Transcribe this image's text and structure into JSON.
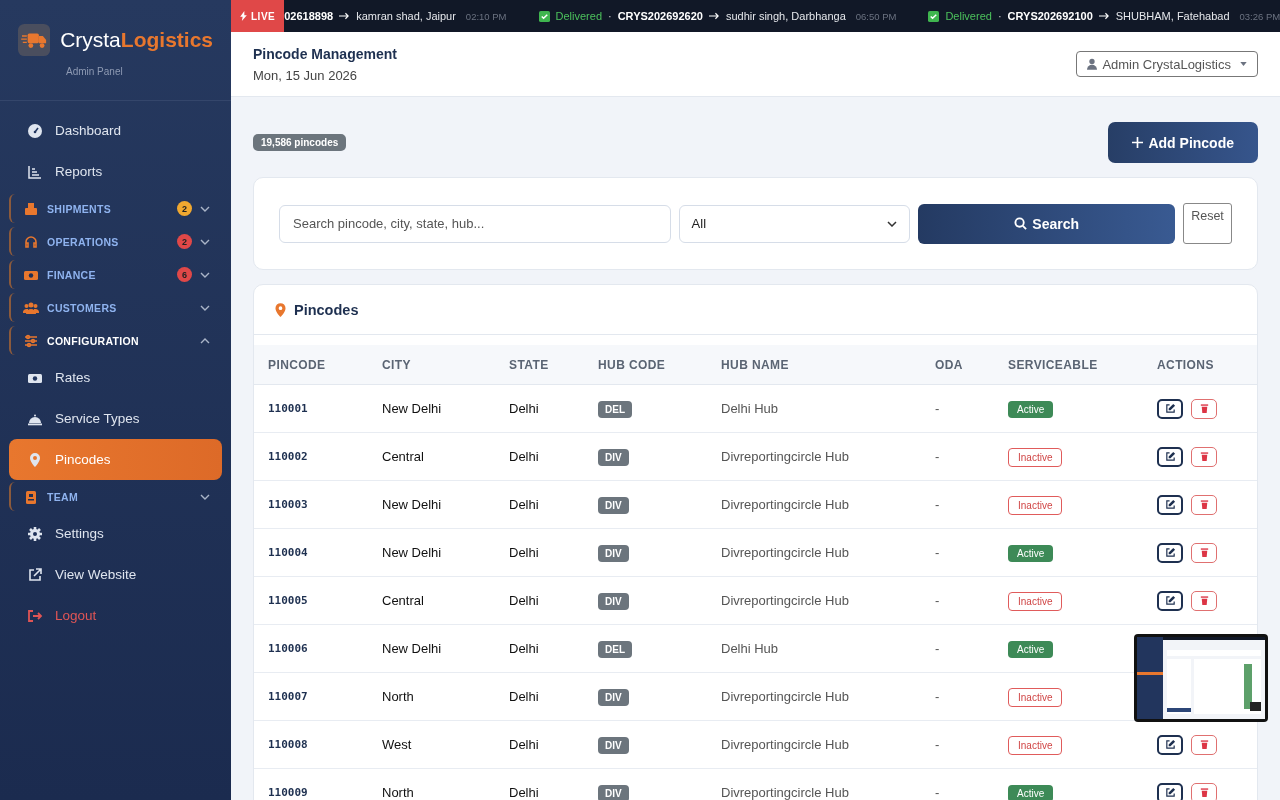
{
  "brand": {
    "name_part1": "Crysta",
    "name_part2": "Logistics",
    "subtitle": "Admin Panel"
  },
  "sidebar": {
    "items": [
      {
        "kind": "link",
        "label": "Dashboard",
        "selected": false
      },
      {
        "kind": "link",
        "label": "Reports",
        "selected": false
      },
      {
        "kind": "group",
        "label": "SHIPMENTS",
        "badge": "2",
        "color": "#f0a830",
        "expanded": false
      },
      {
        "kind": "group",
        "label": "OPERATIONS",
        "badge": "2",
        "color": "#e04848",
        "expanded": false
      },
      {
        "kind": "group",
        "label": "FINANCE",
        "badge": "6",
        "color": "#e04848",
        "expanded": false
      },
      {
        "kind": "group",
        "label": "CUSTOMERS",
        "expanded": false
      },
      {
        "kind": "group",
        "label": "CONFIGURATION",
        "expanded": true
      },
      {
        "kind": "link",
        "label": "Rates",
        "selected": false
      },
      {
        "kind": "link",
        "label": "Service Types",
        "selected": false
      },
      {
        "kind": "link",
        "label": "Pincodes",
        "selected": true
      },
      {
        "kind": "group",
        "label": "TEAM",
        "expanded": false
      },
      {
        "kind": "link",
        "label": "Settings",
        "selected": false
      },
      {
        "kind": "link",
        "label": "View Website",
        "selected": false
      },
      {
        "kind": "logout",
        "label": "Logout",
        "selected": false
      }
    ]
  },
  "ticker": {
    "live_label": "LIVE",
    "items": [
      {
        "id": "02618898",
        "destination": "kamran shad, Jaipur",
        "time": "02:10 PM"
      },
      {
        "status": "Delivered",
        "separator": "·",
        "id": "CRYS202692620",
        "destination": "sudhir singh, Darbhanga",
        "time": "06:50 PM"
      },
      {
        "status": "Delivered",
        "separator": "·",
        "id": "CRYS202692100",
        "destination": "SHUBHAM, Fatehabad",
        "time": "03:26 PM"
      }
    ]
  },
  "header": {
    "title": "Pincode Management",
    "date": "Mon, 15 Jun 2026",
    "user_menu": "Admin CrystaLogistics"
  },
  "count_badge": "19,586 pincodes",
  "add_button": "Add Pincode",
  "filters": {
    "search_placeholder": "Search pincode, city, state, hub...",
    "select_value": "All",
    "search_button": "Search",
    "reset_button": "Reset"
  },
  "table": {
    "title": "Pincodes",
    "columns": [
      "PINCODE",
      "CITY",
      "STATE",
      "HUB CODE",
      "HUB NAME",
      "ODA",
      "SERVICEABLE",
      "ACTIONS"
    ],
    "rows": [
      {
        "pincode": "110001",
        "city": "New Delhi",
        "state": "Delhi",
        "hub_code": "DEL",
        "hub_name": "Delhi Hub",
        "oda": "-",
        "serviceable": "Active",
        "active": true,
        "actions": [
          {
            "kind": "edit"
          },
          {
            "kind": "delete"
          }
        ]
      },
      {
        "pincode": "110002",
        "city": "Central",
        "state": "Delhi",
        "hub_code": "DIV",
        "hub_name": "Divreportingcircle Hub",
        "oda": "-",
        "serviceable": "Inactive",
        "active": false,
        "actions": [
          {
            "kind": "edit"
          },
          {
            "kind": "delete"
          }
        ]
      },
      {
        "pincode": "110003",
        "city": "New Delhi",
        "state": "Delhi",
        "hub_code": "DIV",
        "hub_name": "Divreportingcircle Hub",
        "oda": "-",
        "serviceable": "Inactive",
        "active": false,
        "actions": [
          {
            "kind": "edit"
          },
          {
            "kind": "delete"
          }
        ]
      },
      {
        "pincode": "110004",
        "city": "New Delhi",
        "state": "Delhi",
        "hub_code": "DIV",
        "hub_name": "Divreportingcircle Hub",
        "oda": "-",
        "serviceable": "Active",
        "active": true,
        "actions": [
          {
            "kind": "edit"
          },
          {
            "kind": "delete"
          }
        ]
      },
      {
        "pincode": "110005",
        "city": "Central",
        "state": "Delhi",
        "hub_code": "DIV",
        "hub_name": "Divreportingcircle Hub",
        "oda": "-",
        "serviceable": "Inactive",
        "active": false,
        "actions": [
          {
            "kind": "edit"
          },
          {
            "kind": "delete"
          }
        ]
      },
      {
        "pincode": "110006",
        "city": "New Delhi",
        "state": "Delhi",
        "hub_code": "DEL",
        "hub_name": "Delhi Hub",
        "oda": "-",
        "serviceable": "Active",
        "active": true
      },
      {
        "pincode": "110007",
        "city": "North",
        "state": "Delhi",
        "hub_code": "DIV",
        "hub_name": "Divreportingcircle Hub",
        "oda": "-",
        "serviceable": "Inactive",
        "active": false
      },
      {
        "pincode": "110008",
        "city": "West",
        "state": "Delhi",
        "hub_code": "DIV",
        "hub_name": "Divreportingcircle Hub",
        "oda": "-",
        "serviceable": "Inactive",
        "active": false,
        "actions": [
          {
            "kind": "edit"
          },
          {
            "kind": "delete"
          }
        ]
      },
      {
        "pincode": "110009",
        "city": "North",
        "state": "Delhi",
        "hub_code": "DIV",
        "hub_name": "Divreportingcircle Hub",
        "oda": "-",
        "serviceable": "Active",
        "active": true,
        "actions": [
          {
            "kind": "edit"
          },
          {
            "kind": "delete"
          }
        ]
      }
    ]
  }
}
